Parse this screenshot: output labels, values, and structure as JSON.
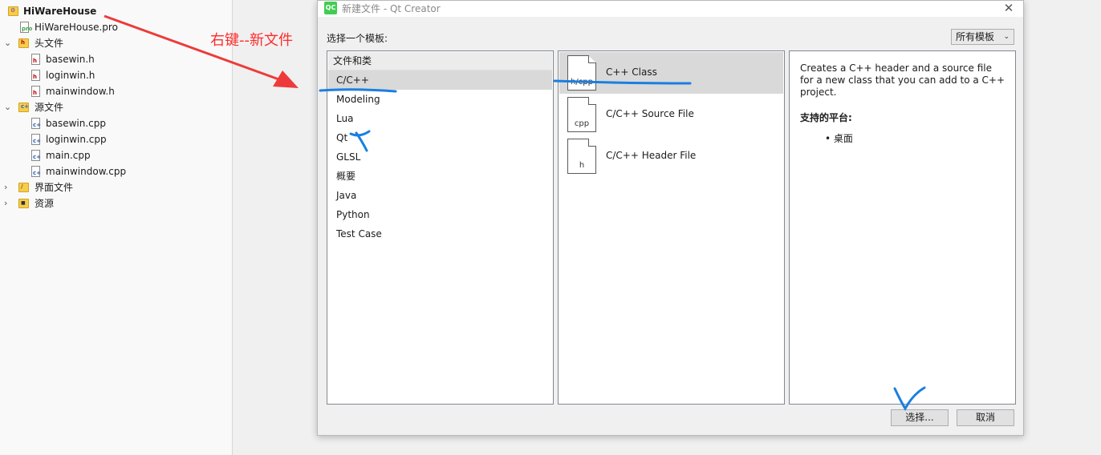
{
  "project_tree": {
    "items": [
      {
        "label": "HiWareHouse",
        "kind": "project",
        "arrow": "",
        "icon": "qt-project-icon"
      },
      {
        "label": "HiWareHouse.pro",
        "kind": "file",
        "tag": "pro",
        "icon": "pro-file-icon"
      },
      {
        "label": "头文件",
        "kind": "folder",
        "arrow": "⌄",
        "tag": "h",
        "icon": "header-folder-icon"
      },
      {
        "label": "basewin.h",
        "kind": "file",
        "tag": "h",
        "icon": "header-file-icon"
      },
      {
        "label": "loginwin.h",
        "kind": "file",
        "tag": "h",
        "icon": "header-file-icon"
      },
      {
        "label": "mainwindow.h",
        "kind": "file",
        "tag": "h",
        "icon": "header-file-icon"
      },
      {
        "label": "源文件",
        "kind": "folder",
        "arrow": "⌄",
        "tag": "c+",
        "icon": "source-folder-icon"
      },
      {
        "label": "basewin.cpp",
        "kind": "file",
        "tag": "c+",
        "icon": "cpp-file-icon"
      },
      {
        "label": "loginwin.cpp",
        "kind": "file",
        "tag": "c+",
        "icon": "cpp-file-icon"
      },
      {
        "label": "main.cpp",
        "kind": "file",
        "tag": "c+",
        "icon": "cpp-file-icon"
      },
      {
        "label": "mainwindow.cpp",
        "kind": "file",
        "tag": "c+",
        "icon": "cpp-file-icon"
      },
      {
        "label": "界面文件",
        "kind": "folder",
        "arrow": "›",
        "tag": "/",
        "icon": "forms-folder-icon"
      },
      {
        "label": "资源",
        "kind": "folder",
        "arrow": "›",
        "tag": "🔒",
        "icon": "resources-folder-icon"
      }
    ]
  },
  "annotation": {
    "text": "右键--新文件",
    "color": "#ff2b2b",
    "marks_color": "#1a7fe0"
  },
  "dialog": {
    "app_icon": "QC",
    "title": "新建文件 - Qt Creator",
    "close_glyph": "✕",
    "choose_label": "选择一个模板:",
    "filter": {
      "selected": "所有模板",
      "chevron": "⌄"
    },
    "category_header": "文件和类",
    "categories": [
      "C/C++",
      "Modeling",
      "Lua",
      "Qt",
      "GLSL",
      "概要",
      "Java",
      "Python",
      "Test Case"
    ],
    "selected_category": "C/C++",
    "templates": [
      {
        "label": "C++ Class",
        "ext": "h/cpp",
        "icon": "cpp-class-icon",
        "selected": true
      },
      {
        "label": "C/C++ Source File",
        "ext": "cpp",
        "icon": "cpp-source-icon",
        "selected": false
      },
      {
        "label": "C/C++ Header File",
        "ext": "h",
        "icon": "cpp-header-icon",
        "selected": false
      }
    ],
    "description": "Creates a C++ header and a source file for a new class that you can add to a C++ project.",
    "platform_heading": "支持的平台:",
    "platform_item": "• 桌面",
    "choose_button": "选择...",
    "cancel_button": "取消"
  },
  "colors": {
    "qt_green": "#41cd52",
    "selection": "#d9d9d9"
  }
}
